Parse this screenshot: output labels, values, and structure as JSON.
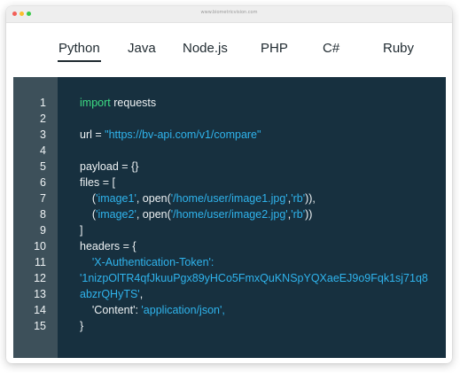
{
  "browser": {
    "url": "www.biometricvision.com"
  },
  "tabs": [
    {
      "label": "Python",
      "active": true
    },
    {
      "label": "Java",
      "active": false
    },
    {
      "label": "Node.js",
      "active": false
    },
    {
      "label": "PHP",
      "active": false
    },
    {
      "label": "C#",
      "active": false
    },
    {
      "label": "Ruby",
      "active": false
    }
  ],
  "colors": {
    "code_background": "#17303f",
    "gutter_background": "#3d505a",
    "keyword": "#3ddc84",
    "string": "#2fb3ec",
    "text": "#eef2f4"
  },
  "code": {
    "line_numbers": [
      "1",
      "2",
      "3",
      "4",
      "5",
      "6",
      "7",
      "8",
      "9",
      "10",
      "11",
      "12",
      "13",
      "14",
      "15"
    ],
    "lines": {
      "l1_keyword": "import",
      "l1_rest": " requests",
      "l3_prefix": "url = ",
      "l3_string": "\"https://bv-api.com/v1/compare\"",
      "l5": "payload = {}",
      "l6": "files = [",
      "l7_indent": "    (",
      "l7_s1": "'image1'",
      "l7_mid": ", open(",
      "l7_s2": "'/home/user/image1.jpg'",
      "l7_comma": ",",
      "l7_s3": "'rb'",
      "l7_end": ")),",
      "l8_indent": "    (",
      "l8_s1": "'image2'",
      "l8_mid": ", open(",
      "l8_s2": "'/home/user/image2.jpg'",
      "l8_comma": ",",
      "l8_s3": "'rb'",
      "l8_end": "))",
      "l9": "]",
      "l10": "headers = {",
      "l11_indent": "    ",
      "l11_string": "'X-Authentication-Token':",
      "l12_string": "'1nizpOlTR4qfJkuuPgx89yHCo5FmxQuKNSpYQXaeEJ9o9Fqk1sj71q8",
      "l13_string": "abzrQHyTS'",
      "l13_end": ",",
      "l14_indent": "    ",
      "l14_key": "'Content'",
      "l14_colon": ": ",
      "l14_value": "'application/json',",
      "l15": "}"
    }
  }
}
